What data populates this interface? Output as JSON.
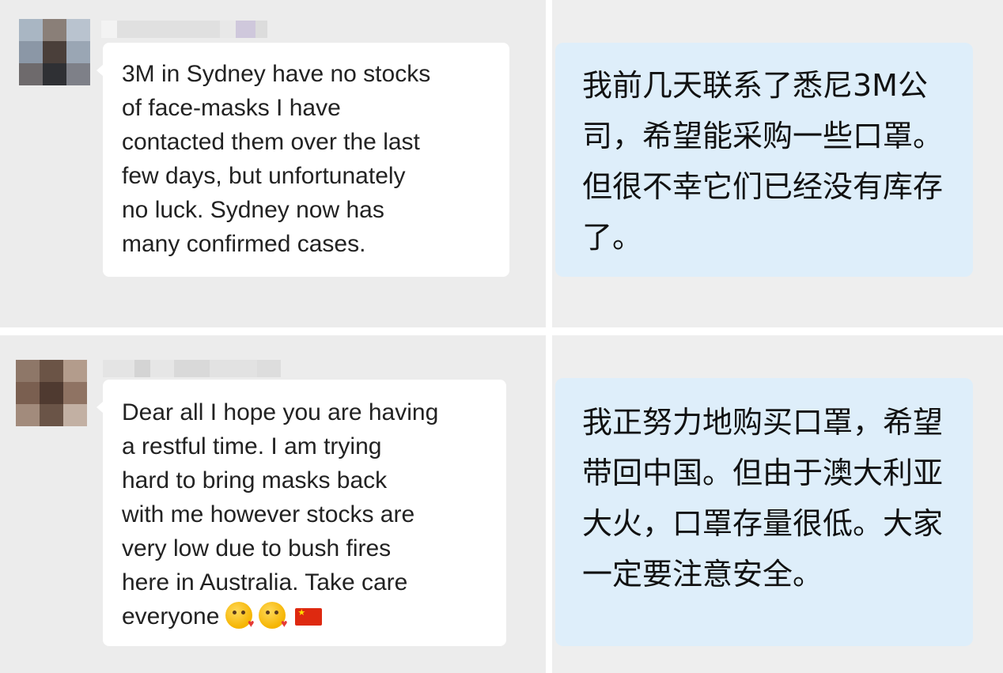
{
  "conversation": [
    {
      "english_text": "3M in Sydney have no stocks\nof face-masks I have\ncontacted them over the last\nfew days, but unfortunately\nno luck. Sydney now has\nmany confirmed cases.",
      "chinese_text": "我前几天联系了悉尼3M公司，希望能采购一些口罩。但很不幸它们已经没有库存了。"
    },
    {
      "english_text": "Dear all I hope you are having\n a restful time. I am trying\nhard to bring masks back\nwith me however stocks are\nvery low due to bush fires\nhere in Australia. Take care\neveryone",
      "emojis": [
        "kissing-face-with-heart-icon",
        "kissing-face-with-heart-icon",
        "china-flag-icon"
      ],
      "chinese_text": "我正努力地购买口罩，希望带回中国。但由于澳大利亚大火，口罩存量很低。大家一定要注意安全。"
    }
  ],
  "colors": {
    "chat_background": "#ececec",
    "incoming_bubble": "#ffffff",
    "translation_bubble": "#deeefa",
    "text": "#222222"
  }
}
